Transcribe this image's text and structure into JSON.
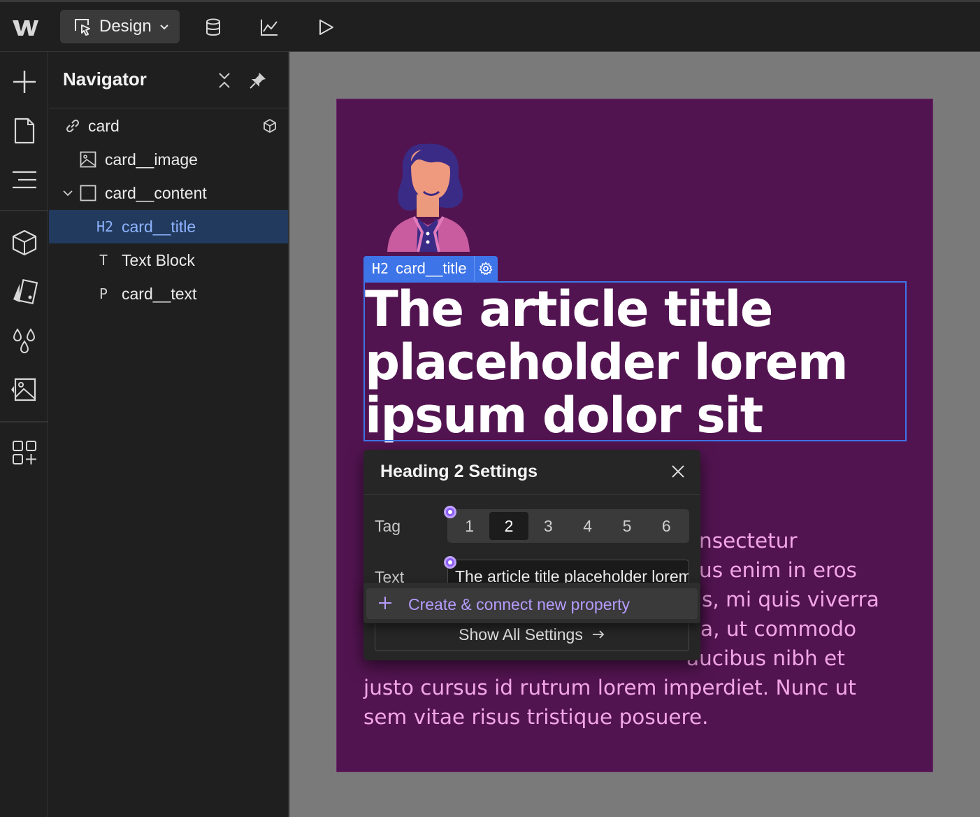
{
  "topbar": {
    "mode_label": "Design",
    "icons": [
      "webflow-logo",
      "cursor-select-icon",
      "chevron-down-icon",
      "database-icon",
      "chart-icon",
      "play-icon"
    ]
  },
  "rail": {
    "icons": [
      "add-icon",
      "page-icon",
      "navigator-icon",
      "components-icon",
      "styles-icon",
      "variables-icon",
      "assets-icon",
      "apps-icon"
    ]
  },
  "navigator": {
    "title": "Navigator",
    "items": [
      {
        "label": "card",
        "icon": "link-icon",
        "prefix": ""
      },
      {
        "label": "card__image",
        "icon": "image-icon",
        "prefix": ""
      },
      {
        "label": "card__content",
        "icon": "box-icon",
        "prefix": ""
      },
      {
        "label": "card__title",
        "icon": "",
        "prefix": "H2"
      },
      {
        "label": "Text Block",
        "icon": "",
        "prefix": "T"
      },
      {
        "label": "card__text",
        "icon": "",
        "prefix": "P"
      }
    ]
  },
  "canvas": {
    "selection_tag": {
      "prefix": "H2",
      "label": "card__title"
    },
    "card_title": "The article title placeholder lorem ipsum dolor sit",
    "card_text": "…nsectetur …us enim in eros …s, mi quis viverra …a, ut commodo …aucibus nibh et justo cursus id rutrum lorem imperdiet. Nunc ut sem vitae risus tristique posuere.",
    "colors": {
      "card_bg": "#521450",
      "title": "#ffffff",
      "text": "#f2a6e6",
      "selection": "#3d74e8"
    }
  },
  "settings": {
    "title": "Heading 2 Settings",
    "tag_label": "Tag",
    "tag_options": [
      "1",
      "2",
      "3",
      "4",
      "5",
      "6"
    ],
    "tag_selected": "2",
    "text_label": "Text",
    "text_value": "The article title placeholder lorem ipsum dolor sit",
    "show_all_label": "Show All Settings",
    "connect_label": "Create & connect new property"
  }
}
